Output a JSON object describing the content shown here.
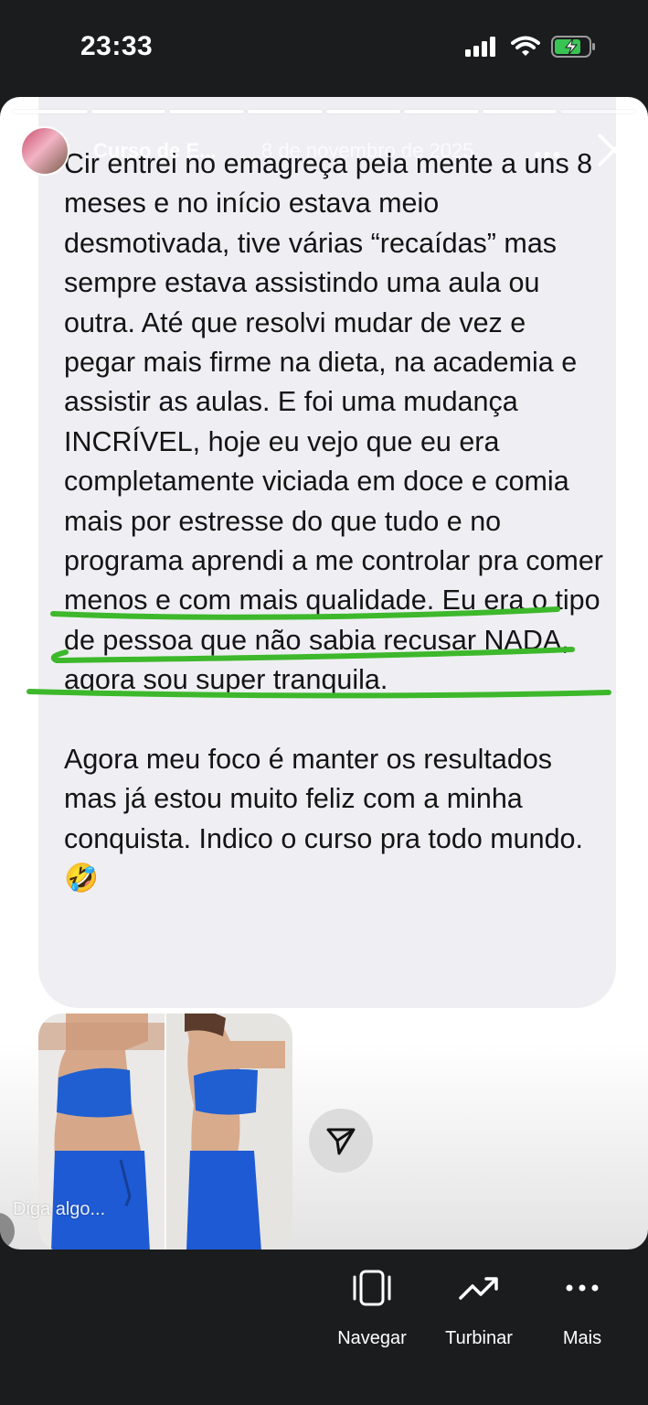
{
  "status_bar": {
    "time": "23:33"
  },
  "story": {
    "progress_segments": 8,
    "account_name": "Curso de E...",
    "date": "8 de novembro de 2025",
    "message_paragraphs": [
      "Cir entrei no emagreça pela mente a uns 8 meses e no início estava meio desmotivada, tive várias “recaídas” mas sempre estava assistindo uma aula ou outra. Até que resolvi mudar de vez e pegar mais firme na dieta, na academia e assistir as aulas. E foi uma mudança INCRÍVEL, hoje eu vejo que eu era completamente viciada em doce e comia mais por estresse do que tudo e no programa aprendi a me controlar pra comer menos e com mais qualidade. Eu era o tipo de pessoa que não sabia recusar NADA, agora sou super tranquila.",
      "Agora meu foco é manter os resultados mas já estou muito feliz com a minha conquista. Indico o curso pra todo mundo. 🤣"
    ],
    "reply_placeholder": "Diga algo...",
    "highlight_color": "#3db82b"
  },
  "actions": [
    {
      "label": "Navegar",
      "icon": "navigate-icon"
    },
    {
      "label": "Turbinar",
      "icon": "boost-icon"
    },
    {
      "label": "Mais",
      "icon": "more-icon"
    }
  ]
}
